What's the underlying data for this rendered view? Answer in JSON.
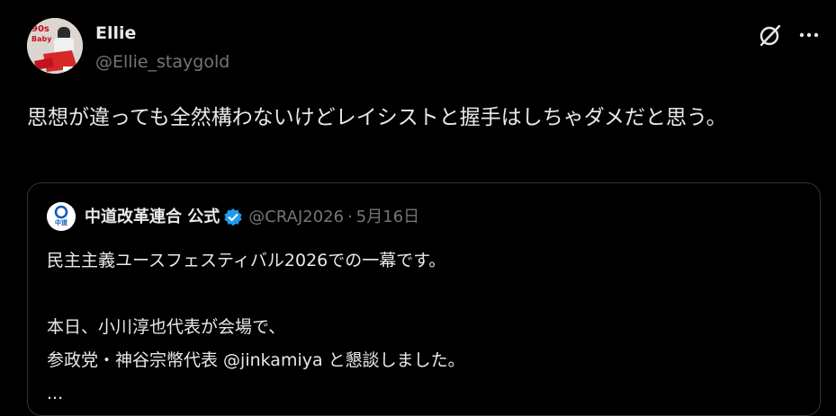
{
  "author": {
    "display_name": "Ellie",
    "handle": "@Ellie_staygold",
    "avatar_text": [
      "90s",
      "Baby"
    ]
  },
  "post": {
    "text": "思想が違っても全然構わないけどレイシストと握手はしちゃダメだと思う。"
  },
  "icons": {
    "grok": "grok-icon",
    "more": "more-icon",
    "verified": "verified-badge-icon"
  },
  "quote": {
    "display_name": "中道改革連合 公式",
    "handle": "@CRAJ2026",
    "separator": "·",
    "date": "5月16日",
    "avatar_text": "中道",
    "lines": [
      "民主主義ユースフェスティバル2026での一幕です。",
      "",
      "本日、小川淳也代表が会場で、",
      "参政党・神谷宗幣代表 @jinkamiya と懇談しました。",
      "..."
    ]
  },
  "colors": {
    "background": "#000000",
    "text": "#e7e9ea",
    "muted": "#71767b",
    "border": "#2f3336",
    "verified": "#1d9bf0",
    "party_blue": "#0a5bb5"
  }
}
